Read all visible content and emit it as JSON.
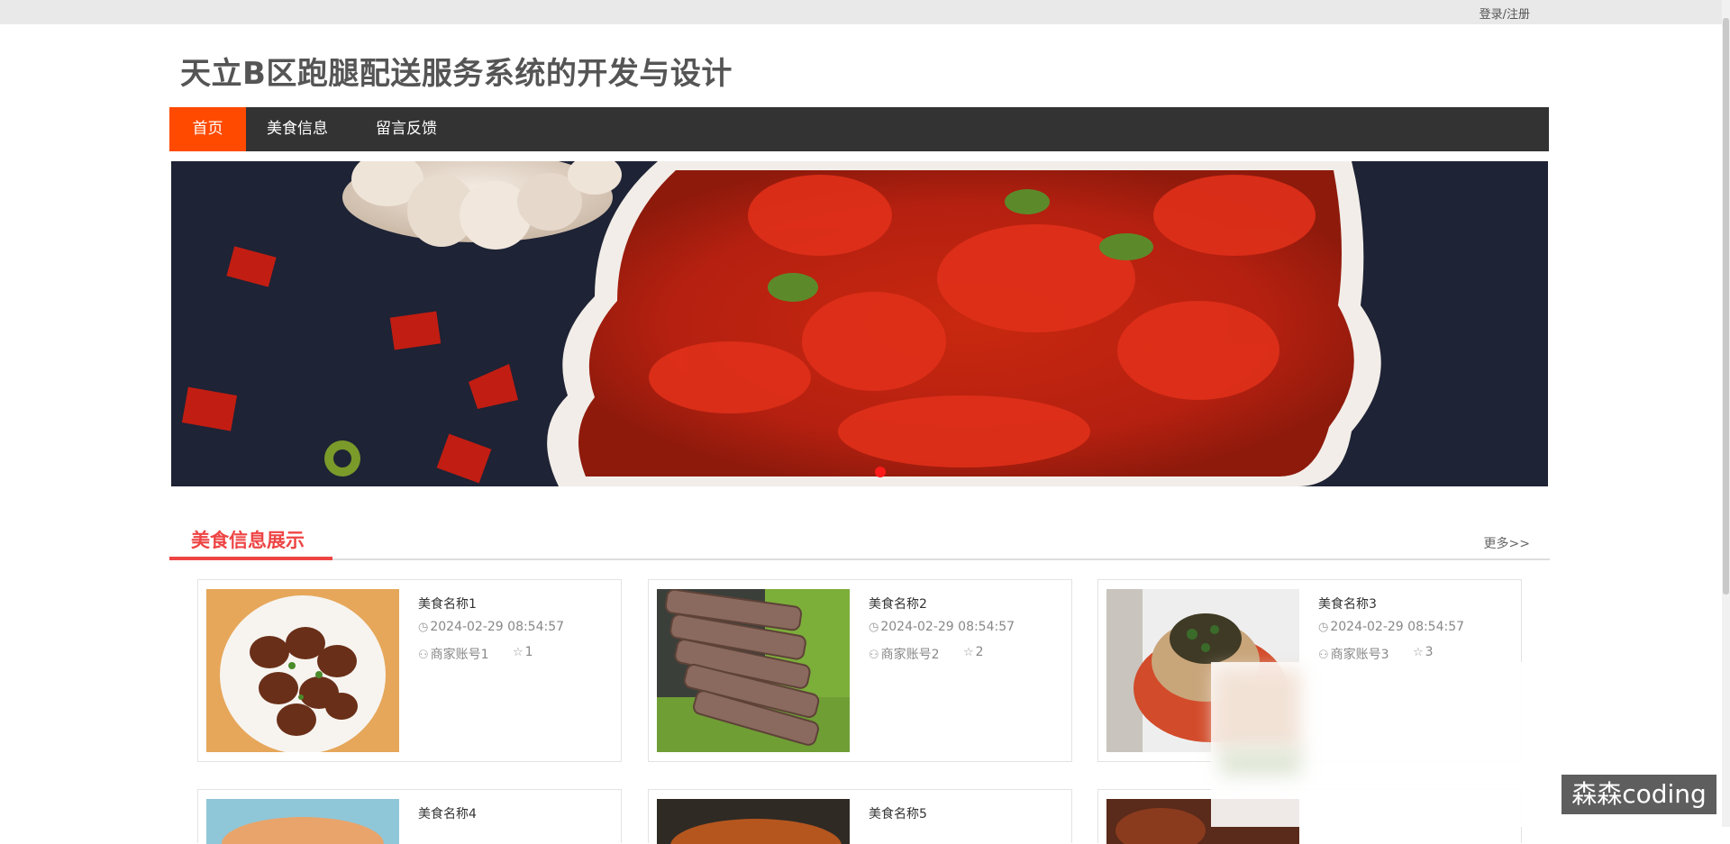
{
  "topbar": {
    "login_label": "登录/注册"
  },
  "site": {
    "title": "天立B区跑腿配送服务系统的开发与设计"
  },
  "nav": {
    "items": [
      {
        "label": "首页",
        "active": true
      },
      {
        "label": "美食信息",
        "active": false
      },
      {
        "label": "留言反馈",
        "active": false
      }
    ]
  },
  "colors": {
    "accent": "#ff4a00",
    "section": "#ee4444",
    "nav_bg": "#333333"
  },
  "section": {
    "title": "美食信息展示",
    "more": "更多>>"
  },
  "cards": [
    {
      "name": "美食名称1",
      "time": "2024-02-29 08:54:57",
      "owner": "商家账号1",
      "fav": "1"
    },
    {
      "name": "美食名称2",
      "time": "2024-02-29 08:54:57",
      "owner": "商家账号2",
      "fav": "2"
    },
    {
      "name": "美食名称3",
      "time": "2024-02-29 08:54:57",
      "owner": "商家账号3",
      "fav": "3"
    },
    {
      "name": "美食名称4"
    },
    {
      "name": "美食名称5"
    }
  ],
  "icons": {
    "clock": "clock-icon",
    "user": "user-icon",
    "star": "star-icon"
  },
  "watermark": "森森coding"
}
